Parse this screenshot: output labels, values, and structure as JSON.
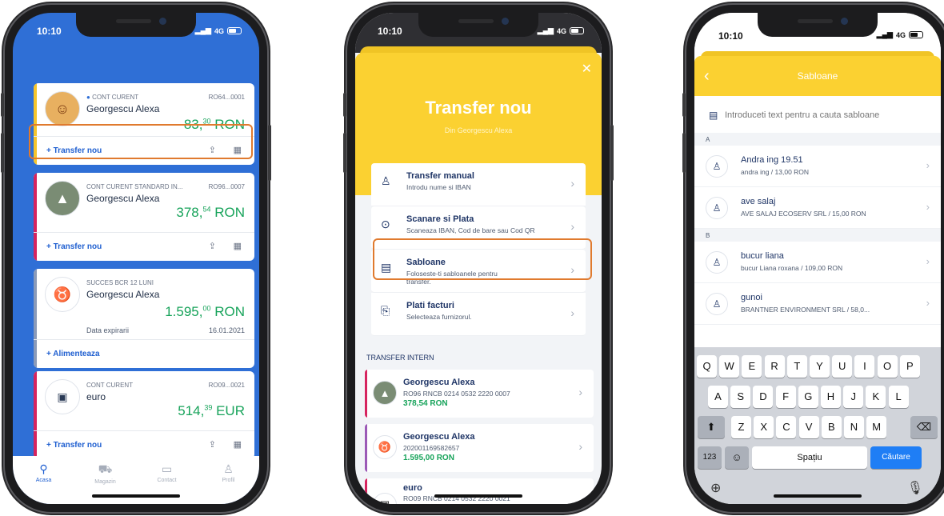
{
  "status": {
    "time": "10:10",
    "network": "4G"
  },
  "screen1": {
    "accounts": [
      {
        "type": "CONT CURENT",
        "iban_short": "RO64...0001",
        "name": "Georgescu Alexa",
        "amount_int": "83,",
        "amount_dec": "30",
        "currency": "RON",
        "action": "Transfer nou"
      },
      {
        "type": "CONT CURENT STANDARD IN...",
        "iban_short": "RO96...0007",
        "name": "Georgescu Alexa",
        "amount_int": "378,",
        "amount_dec": "54",
        "currency": "RON",
        "action": "Transfer nou"
      },
      {
        "type": "SUCCES BCR 12 LUNI",
        "iban_short": "",
        "name": "Georgescu Alexa",
        "amount_int": "1.595,",
        "amount_dec": "00",
        "currency": "RON",
        "expiry_label": "Data expirarii",
        "expiry_value": "16.01.2021",
        "action": "Alimenteaza"
      },
      {
        "type": "CONT CURENT",
        "iban_short": "RO09...0021",
        "name": "euro",
        "amount_int": "514,",
        "amount_dec": "39",
        "currency": "EUR",
        "action": "Transfer nou"
      }
    ],
    "tabs": [
      "Acasa",
      "Magazin",
      "Contact",
      "Profil"
    ]
  },
  "screen2": {
    "title": "Transfer nou",
    "subtitle": "Din Georgescu Alexa",
    "options": [
      {
        "title": "Transfer manual",
        "sub": "Introdu nume si IBAN"
      },
      {
        "title": "Scanare si Plata",
        "sub": "Scaneaza IBAN, Cod de bare sau Cod QR"
      },
      {
        "title": "Sabloane",
        "sub": "Foloseste-ti sabloanele pentru transfer."
      },
      {
        "title": "Plati facturi",
        "sub": "Selecteaza furnizorul."
      }
    ],
    "section": "TRANSFER INTERN",
    "internal": [
      {
        "name": "Georgescu Alexa",
        "iban": "RO96 RNCB 0214 0532 2220 0007",
        "amount": "378,54 RON"
      },
      {
        "name": "Georgescu Alexa",
        "iban": "202001169582657",
        "amount": "1.595,00 RON"
      },
      {
        "name": "euro",
        "iban": "RO09 RNCB 0214 0532 2220 0021",
        "amount": ""
      }
    ]
  },
  "screen3": {
    "title": "Sabloane",
    "search_placeholder": "Introduceti text pentru a cauta sabloane",
    "sections": [
      {
        "letter": "A",
        "items": [
          {
            "name": "Andra ing 19.51",
            "detail": "andra ing / 13,00 RON"
          },
          {
            "name": "ave salaj",
            "detail": "AVE SALAJ ECOSERV SRL / 15,00 RON"
          }
        ]
      },
      {
        "letter": "B",
        "items": [
          {
            "name": "bucur liana",
            "detail": "bucur Liana roxana / 109,00 RON"
          },
          {
            "name": "gunoi",
            "detail": "BRANTNER ENVIRONMENT SRL / 58,0..."
          }
        ]
      }
    ],
    "keyboard": {
      "row1": [
        "Q",
        "W",
        "E",
        "R",
        "T",
        "Y",
        "U",
        "I",
        "O",
        "P"
      ],
      "row2": [
        "A",
        "S",
        "D",
        "F",
        "G",
        "H",
        "J",
        "K",
        "L"
      ],
      "row3": [
        "Z",
        "X",
        "C",
        "V",
        "B",
        "N",
        "M"
      ],
      "num": "123",
      "space": "Spațiu",
      "search": "Căutare"
    }
  },
  "colors": {
    "bcr_blue": "#2f6fd6",
    "bcr_yellow": "#fbd131",
    "highlight": "#e07a2e",
    "green": "#17a35a"
  }
}
